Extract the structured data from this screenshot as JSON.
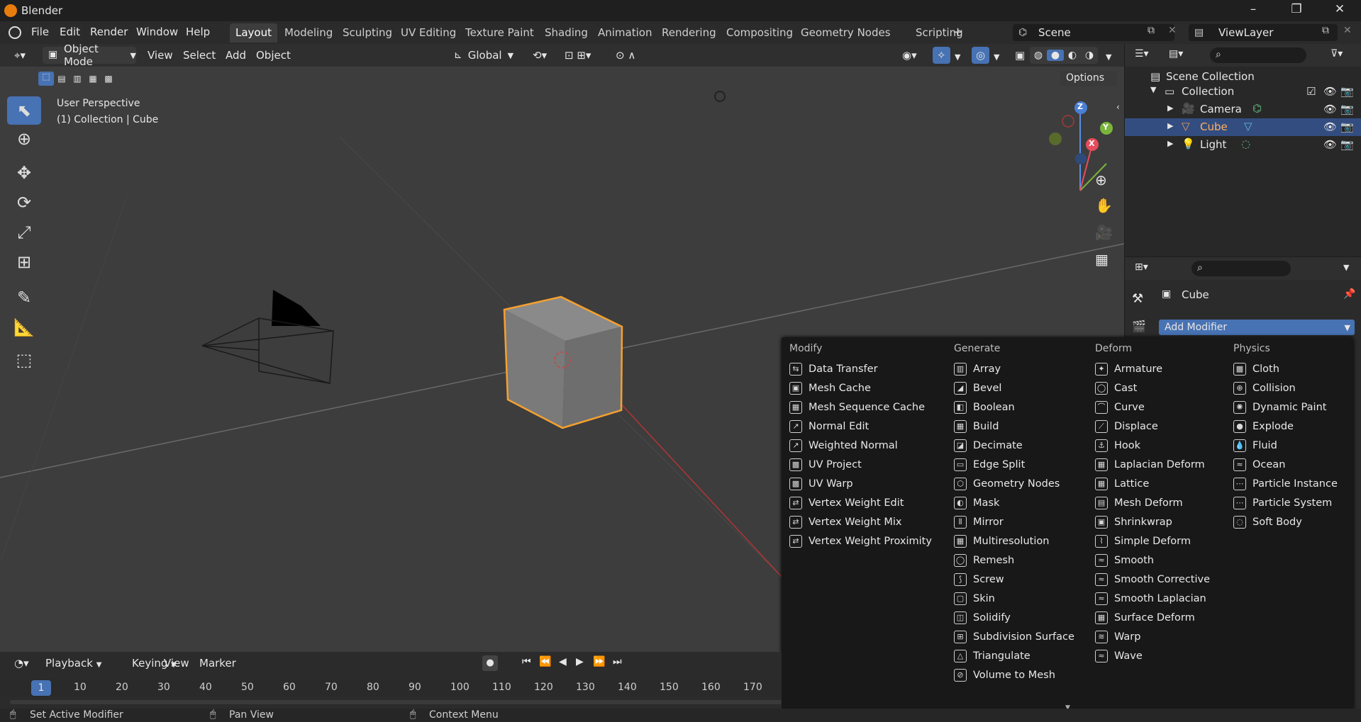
{
  "app": {
    "title": "Blender"
  },
  "menubar": {
    "items": [
      "File",
      "Edit",
      "Render",
      "Window",
      "Help"
    ],
    "workspaces": [
      "Layout",
      "Modeling",
      "Sculpting",
      "UV Editing",
      "Texture Paint",
      "Shading",
      "Animation",
      "Rendering",
      "Compositing",
      "Geometry Nodes",
      "Scripting"
    ],
    "active_workspace": "Layout",
    "scene": "Scene",
    "view_layer": "ViewLayer"
  },
  "viewport_header": {
    "mode": "Object Mode",
    "menus": [
      "View",
      "Select",
      "Add",
      "Object"
    ],
    "orientation": "Global",
    "options": "Options"
  },
  "viewport": {
    "perspective": "User Perspective",
    "context": "(1) Collection | Cube",
    "gizmo": {
      "x": "X",
      "y": "Y",
      "z": "Z"
    }
  },
  "outliner": {
    "root": "Scene Collection",
    "collection": "Collection",
    "items": [
      {
        "name": "Camera",
        "icon": "camera-icon",
        "selected": false
      },
      {
        "name": "Cube",
        "icon": "mesh-icon",
        "selected": true
      },
      {
        "name": "Light",
        "icon": "light-icon",
        "selected": false
      }
    ]
  },
  "properties": {
    "object_name": "Cube",
    "add_modifier": "Add Modifier"
  },
  "modifier_menu": {
    "columns": [
      {
        "title": "Modify",
        "items": [
          "Data Transfer",
          "Mesh Cache",
          "Mesh Sequence Cache",
          "Normal Edit",
          "Weighted Normal",
          "UV Project",
          "UV Warp",
          "Vertex Weight Edit",
          "Vertex Weight Mix",
          "Vertex Weight Proximity"
        ]
      },
      {
        "title": "Generate",
        "items": [
          "Array",
          "Bevel",
          "Boolean",
          "Build",
          "Decimate",
          "Edge Split",
          "Geometry Nodes",
          "Mask",
          "Mirror",
          "Multiresolution",
          "Remesh",
          "Screw",
          "Skin",
          "Solidify",
          "Subdivision Surface",
          "Triangulate",
          "Volume to Mesh"
        ]
      },
      {
        "title": "Deform",
        "items": [
          "Armature",
          "Cast",
          "Curve",
          "Displace",
          "Hook",
          "Laplacian Deform",
          "Lattice",
          "Mesh Deform",
          "Shrinkwrap",
          "Simple Deform",
          "Smooth",
          "Smooth Corrective",
          "Smooth Laplacian",
          "Surface Deform",
          "Warp",
          "Wave"
        ]
      },
      {
        "title": "Physics",
        "items": [
          "Cloth",
          "Collision",
          "Dynamic Paint",
          "Explode",
          "Fluid",
          "Ocean",
          "Particle Instance",
          "Particle System",
          "Soft Body"
        ]
      }
    ]
  },
  "timeline": {
    "menus": [
      "Playback",
      "Keying",
      "View",
      "Marker"
    ],
    "current_frame": "1",
    "ticks": [
      "10",
      "20",
      "30",
      "40",
      "50",
      "60",
      "70",
      "80",
      "90",
      "100",
      "110",
      "120",
      "130",
      "140",
      "150",
      "160",
      "170"
    ]
  },
  "statusbar": {
    "items": [
      "Set Active Modifier",
      "Pan View",
      "Context Menu"
    ]
  },
  "colors": {
    "accent": "#4772b3",
    "selection": "#334d80",
    "cube_outline": "#f5a030"
  }
}
